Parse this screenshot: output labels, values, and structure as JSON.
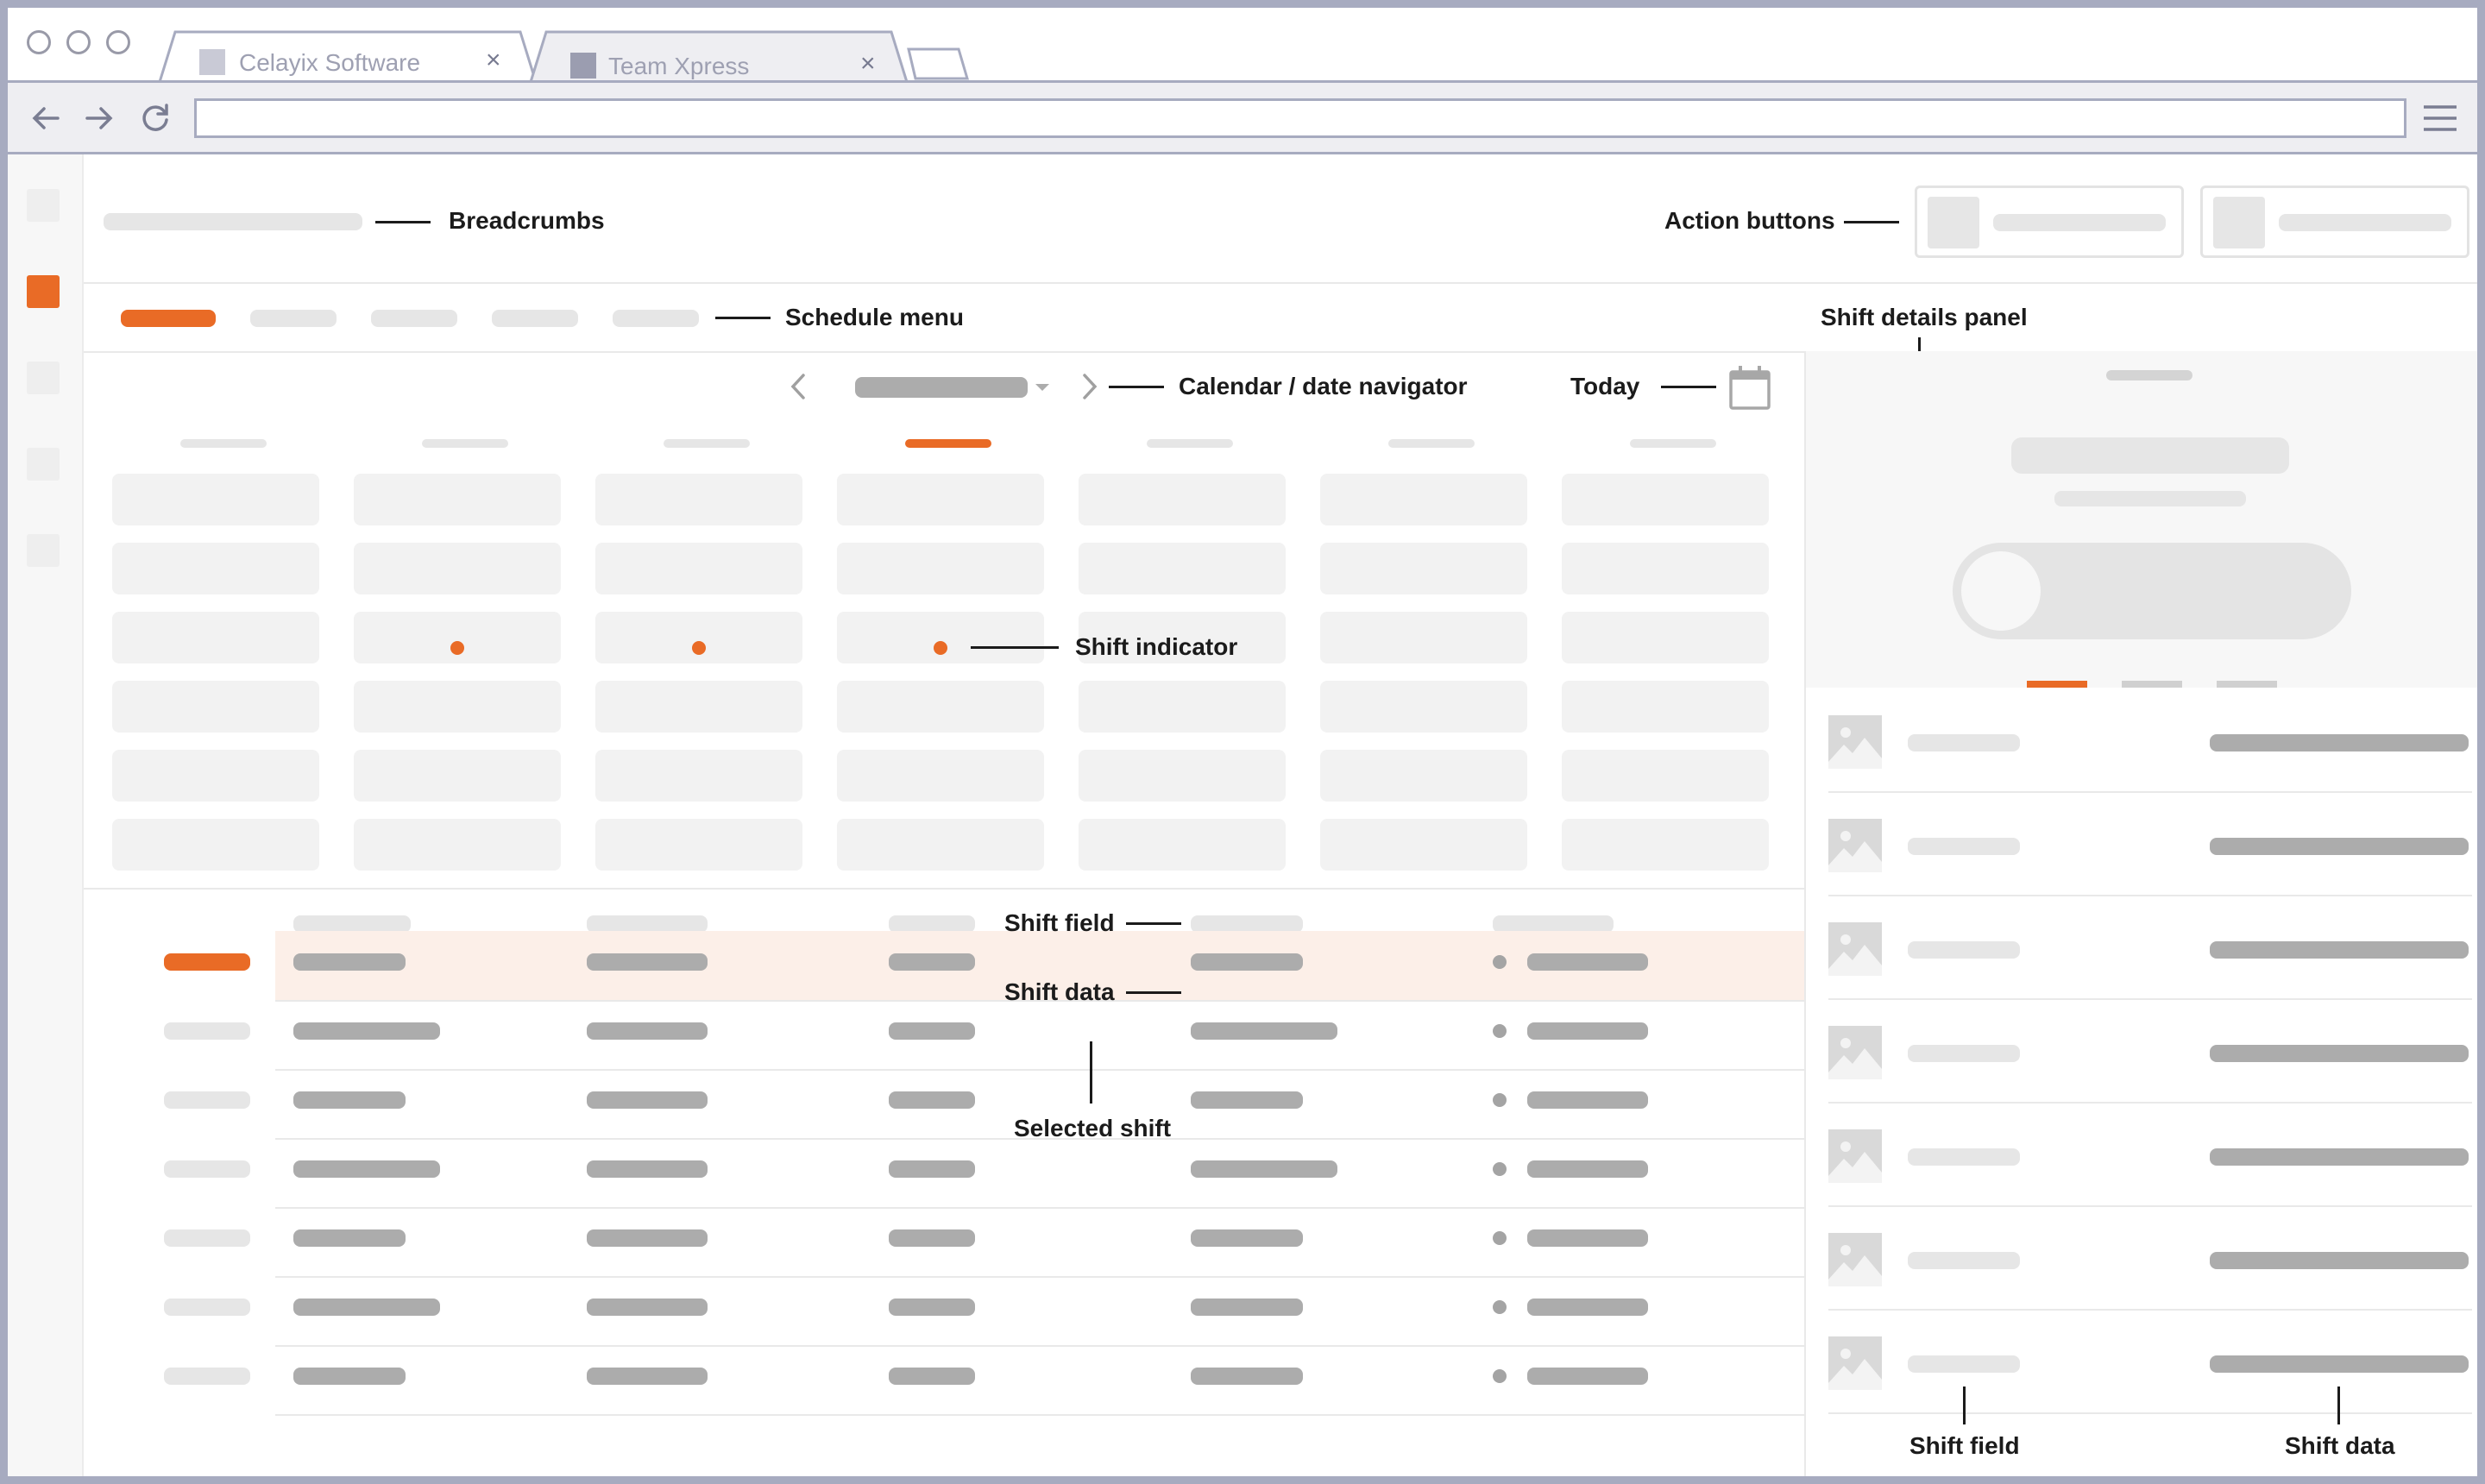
{
  "browser": {
    "tabs": [
      {
        "title": "Celayix Software",
        "close": "×",
        "active": false,
        "fav_color": "#c9cad6"
      },
      {
        "title": "Team Xpress",
        "close": "×",
        "active": true,
        "fav_color": "#9b9db0"
      }
    ],
    "icons": {
      "back": "arrow-left",
      "forward": "arrow-right",
      "reload": "reload",
      "menu": "hamburger"
    }
  },
  "annotations": {
    "breadcrumbs": "Breadcrumbs",
    "action_buttons": "Action buttons",
    "schedule_menu": "Schedule menu",
    "shift_details_panel": "Shift details panel",
    "calendar_navigator": "Calendar / date navigator",
    "today": "Today",
    "shift_indicator": "Shift indicator",
    "shift_field": "Shift field",
    "shift_data": "Shift data",
    "selected_shift": "Selected shift",
    "panel_shift_field": "Shift field",
    "panel_shift_data": "Shift data"
  },
  "calendar": {
    "active_day_index": 3,
    "weeks": 6,
    "days": 7,
    "shift_indicator_cells": [
      [
        2,
        1
      ],
      [
        2,
        2
      ],
      [
        2,
        3
      ]
    ]
  },
  "shift_table": {
    "rows": 7,
    "selected_row": 0
  },
  "panel": {
    "list_items": 7,
    "active_tab_index": 0
  },
  "colors": {
    "accent": "#e96b26",
    "frame": "#a7abc0",
    "selected_row": "#fcefe8",
    "placeholder_light": "#e6e6e6",
    "placeholder_dark": "#acacac"
  }
}
